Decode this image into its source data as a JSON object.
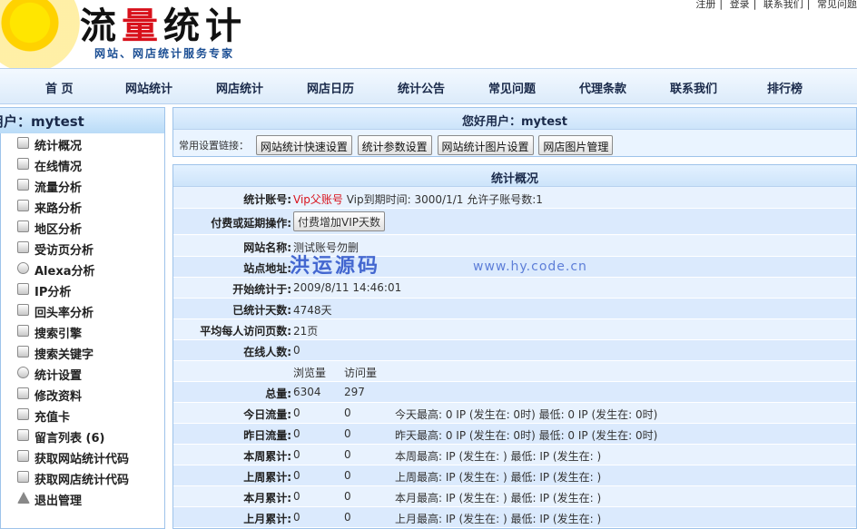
{
  "header": {
    "logo_title_part1": "流",
    "logo_title_part2": "量",
    "logo_title_part3": "统计",
    "slogan": "网站、网店统计服务专家",
    "top_links": [
      "注册",
      "登录",
      "联系我们",
      "常见问题"
    ]
  },
  "nav": {
    "items": [
      "首 页",
      "网站统计",
      "网店统计",
      "网店日历",
      "统计公告",
      "常见问题",
      "代理条款",
      "联系我们",
      "排行榜"
    ]
  },
  "sidebar": {
    "title": "用户：mytest",
    "items": [
      {
        "label": "统计概况",
        "icon": "overview-icon"
      },
      {
        "label": "在线情况",
        "icon": "online-icon"
      },
      {
        "label": "流量分析",
        "icon": "traffic-icon"
      },
      {
        "label": "来路分析",
        "icon": "referrer-icon"
      },
      {
        "label": "地区分析",
        "icon": "region-icon"
      },
      {
        "label": "受访页分析",
        "icon": "page-icon"
      },
      {
        "label": "Alexa分析",
        "icon": "alexa-icon"
      },
      {
        "label": "IP分析",
        "icon": "ip-icon"
      },
      {
        "label": "回头率分析",
        "icon": "return-icon"
      },
      {
        "label": "搜索引擎",
        "icon": "search-engine-icon"
      },
      {
        "label": "搜索关键字",
        "icon": "keyword-icon"
      },
      {
        "label": "统计设置",
        "icon": "settings-icon"
      },
      {
        "label": "修改资料",
        "icon": "edit-icon"
      },
      {
        "label": "充值卡",
        "icon": "card-icon"
      },
      {
        "label": "留言列表 (6)",
        "icon": "message-icon"
      },
      {
        "label": "获取网站统计代码",
        "icon": "code-icon"
      },
      {
        "label": "获取网店统计代码",
        "icon": "code-icon"
      },
      {
        "label": "退出管理",
        "icon": "logout-icon"
      }
    ]
  },
  "greeting_panel": {
    "title": "您好用户：mytest",
    "quick_label": "常用设置链接：",
    "buttons": [
      "网站统计快速设置",
      "统计参数设置",
      "网站统计图片设置",
      "网店图片管理"
    ]
  },
  "overview": {
    "title": "统计概况",
    "account_label": "统计账号:",
    "account_value": "Vip父账号",
    "account_extra": "Vip到期时间: 3000/1/1 允许子账号数:1",
    "pay_label": "付费或延期操作:",
    "pay_button": "付费增加VIP天数",
    "site_name_label": "网站名称:",
    "site_name_value": "测试账号勿删",
    "site_url_label": "站点地址:",
    "site_url_value": "",
    "start_label": "开始统计于:",
    "start_value": "2009/8/11 14:46:01",
    "days_label": "已统计天数:",
    "days_value": "4748天",
    "avg_label": "平均每人访问页数:",
    "avg_value": "21页",
    "online_label": "在线人数:",
    "online_value": "0",
    "col_pv": "浏览量",
    "col_uv": "访问量",
    "rows": [
      {
        "label": "总量:",
        "pv": "6304",
        "uv": "297",
        "extra": ""
      },
      {
        "label": "今日流量:",
        "pv": "0",
        "uv": "0",
        "extra": "今天最高:   0 IP (发生在: 0时) 最低:   0 IP (发生在: 0时)"
      },
      {
        "label": "昨日流量:",
        "pv": "0",
        "uv": "0",
        "extra": "昨天最高:   0 IP (发生在: 0时) 最低:   0 IP (发生在: 0时)"
      },
      {
        "label": "本周累计:",
        "pv": "0",
        "uv": "0",
        "extra": "本周最高:   IP (发生在: ) 最低:   IP (发生在: )"
      },
      {
        "label": "上周累计:",
        "pv": "0",
        "uv": "0",
        "extra": "上周最高:   IP (发生在: ) 最低:   IP (发生在: )"
      },
      {
        "label": "本月累计:",
        "pv": "0",
        "uv": "0",
        "extra": "本月最高:   IP (发生在: ) 最低:   IP (发生在: )"
      },
      {
        "label": "上月累计:",
        "pv": "0",
        "uv": "0",
        "extra": "上月最高:   IP (发生在: ) 最低:   IP (发生在: )"
      }
    ],
    "watermark": "洪运源码",
    "watermark_url": "www.hy.code.cn"
  }
}
